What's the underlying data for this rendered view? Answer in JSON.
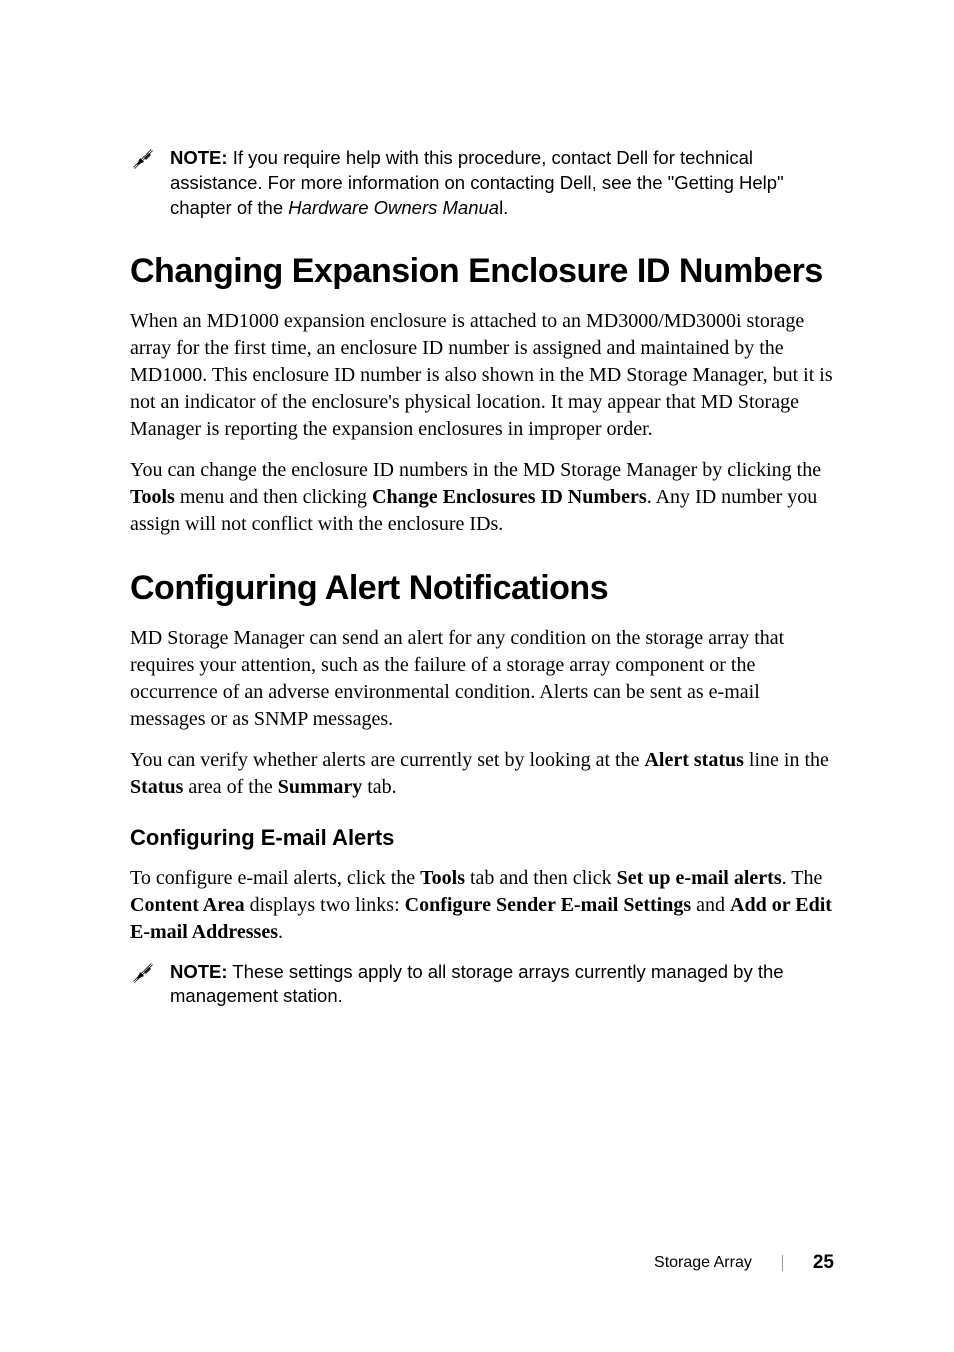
{
  "note1": {
    "label": "NOTE:",
    "text_before_italic": " If you require help with this procedure, contact Dell for technical assistance. For more information on contacting Dell, see the \"Getting Help\" chapter of the ",
    "italic_text": "Hardware Owners Manua",
    "text_after_italic": "l."
  },
  "section1": {
    "heading": "Changing Expansion Enclosure ID Numbers",
    "para1": "When an MD1000 expansion enclosure is attached to an MD3000/MD3000i storage array for the first time, an enclosure ID number is assigned and maintained by the MD1000. This enclosure ID number is also shown in the MD Storage Manager, but it is not an indicator of the enclosure's physical location. It may appear that MD Storage Manager is reporting the expansion enclosures in improper order.",
    "para2_prefix": "You can change the enclosure ID numbers in the MD Storage Manager by clicking the ",
    "para2_bold1": "Tools",
    "para2_mid": " menu and then clicking ",
    "para2_bold2": "Change Enclosures ID Numbers",
    "para2_suffix": ". Any ID number you assign will not conflict with the enclosure IDs."
  },
  "section2": {
    "heading": "Configuring Alert Notifications",
    "para1": "MD Storage Manager can send an alert for any condition on the storage array that requires your attention, such as the failure of a storage array component or the occurrence of an adverse environmental condition. Alerts can be sent as e-mail messages or as SNMP messages.",
    "para2_prefix": "You can verify whether alerts are currently set by looking at the ",
    "para2_bold1": "Alert status",
    "para2_mid1": " line in the ",
    "para2_bold2": "Status",
    "para2_mid2": " area of the ",
    "para2_bold3": "Summary",
    "para2_suffix": " tab."
  },
  "subsection": {
    "heading": "Configuring E-mail Alerts",
    "para_prefix": "To configure e-mail alerts, click the ",
    "bold1": "Tools",
    "mid1": " tab and then click ",
    "bold2": "Set up e-mail alerts",
    "mid2": ". The ",
    "bold3": "Content Area",
    "mid3": " displays two links: ",
    "bold4": "Configure Sender E-mail Settings",
    "mid4": " and ",
    "bold5": "Add or Edit E-mail Addresses",
    "suffix": "."
  },
  "note2": {
    "label": "NOTE:",
    "text": " These settings apply to all storage arrays currently managed by the management station."
  },
  "footer": {
    "section_name": "Storage Array",
    "page_number": "25"
  }
}
